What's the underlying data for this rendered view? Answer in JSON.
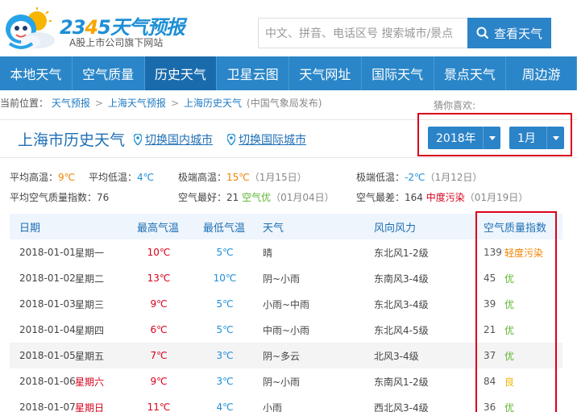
{
  "header": {
    "logo_digits": [
      "2",
      "3",
      "4",
      "5"
    ],
    "logo_text": "天气预报",
    "logo_sub": "A股上市公司旗下网站",
    "search_placeholder": "中文、拼音、电话区号 搜索城市/景点",
    "search_button": "查看天气",
    "search_icon": "search-icon"
  },
  "nav": {
    "items": [
      {
        "label": "本地天气",
        "width": 91
      },
      {
        "label": "空气质量",
        "width": 91
      },
      {
        "label": "历史天气",
        "width": 91,
        "active": true
      },
      {
        "label": "卫星云图",
        "width": 91
      },
      {
        "label": "天气网址",
        "width": 91
      },
      {
        "label": "国际天气",
        "width": 91
      },
      {
        "label": "景点天气",
        "width": 91
      },
      {
        "label": "周边游",
        "width": 89
      }
    ]
  },
  "breadcrumb": {
    "prefix": "当前位置：",
    "links": [
      "天气预报",
      "上海天气预报",
      "上海历史天气"
    ],
    "sep": ">",
    "note": "(中国气象局发布)"
  },
  "guess_label": "猜你喜欢:",
  "title": {
    "text": "上海市历史天气",
    "switch_domestic": "切换国内城市",
    "switch_intl": "切换国际城市"
  },
  "selectors": {
    "year": "2018年",
    "month": "1月"
  },
  "stats": {
    "avg_high_label": "平均高温：",
    "avg_high": "9℃",
    "avg_low_label": "平均低温：",
    "avg_low": "4℃",
    "max_high_label": "极端高温：",
    "max_high": "15℃",
    "max_high_date": "（1月15日）",
    "min_low_label": "极端低温：",
    "min_low": "-2℃",
    "min_low_date": "（1月12日）",
    "avg_aqi_label": "平均空气质量指数：",
    "avg_aqi": "76",
    "best_label": "空气最好：",
    "best_value": "21",
    "best_level": "空气优",
    "best_date": "（01月04日）",
    "worst_label": "空气最差：",
    "worst_value": "164",
    "worst_level": "中度污染",
    "worst_date": "（01月19日）"
  },
  "table": {
    "headers": [
      "日期",
      "最高气温",
      "最低气温",
      "天气",
      "风向风力",
      "空气质量指数"
    ],
    "rows": [
      {
        "date": "2018-01-01",
        "week": "星期一",
        "high": "10℃",
        "low": "5℃",
        "weather": "晴",
        "wind": "东北风1-2级",
        "aqi": "139",
        "level": "轻度污染",
        "level_class": "lvl-light",
        "weekend": false,
        "alt": false
      },
      {
        "date": "2018-01-02",
        "week": "星期二",
        "high": "13℃",
        "low": "10℃",
        "weather": "阴~小雨",
        "wind": "东南风3-4级",
        "aqi": "45",
        "level": "优",
        "level_class": "lvl-good",
        "weekend": false,
        "alt": false
      },
      {
        "date": "2018-01-03",
        "week": "星期三",
        "high": "9℃",
        "low": "5℃",
        "weather": "小雨~中雨",
        "wind": "东北风3-4级",
        "aqi": "39",
        "level": "优",
        "level_class": "lvl-good",
        "weekend": false,
        "alt": false
      },
      {
        "date": "2018-01-04",
        "week": "星期四",
        "high": "6℃",
        "low": "5℃",
        "weather": "中雨~小雨",
        "wind": "东北风4-5级",
        "aqi": "21",
        "level": "优",
        "level_class": "lvl-good",
        "weekend": false,
        "alt": false
      },
      {
        "date": "2018-01-05",
        "week": "星期五",
        "high": "7℃",
        "low": "3℃",
        "weather": "阴~多云",
        "wind": "北风3-4级",
        "aqi": "37",
        "level": "优",
        "level_class": "lvl-good",
        "weekend": false,
        "alt": true
      },
      {
        "date": "2018-01-06",
        "week": "星期六",
        "high": "9℃",
        "low": "3℃",
        "weather": "阴~小雨",
        "wind": "东南风1-2级",
        "aqi": "84",
        "level": "良",
        "level_class": "lvl-mid",
        "weekend": true,
        "alt": false
      },
      {
        "date": "2018-01-07",
        "week": "星期日",
        "high": "11℃",
        "low": "4℃",
        "weather": "小雨",
        "wind": "西北风3-4级",
        "aqi": "36",
        "level": "优",
        "level_class": "lvl-good",
        "weekend": true,
        "alt": false
      }
    ]
  },
  "colors": {
    "brand_blue": "#2a86c8",
    "nav_active": "#1a6bac",
    "highlight_red": "#d9001b",
    "temp_high": "#d9001b",
    "temp_low": "#1e8fd6"
  }
}
